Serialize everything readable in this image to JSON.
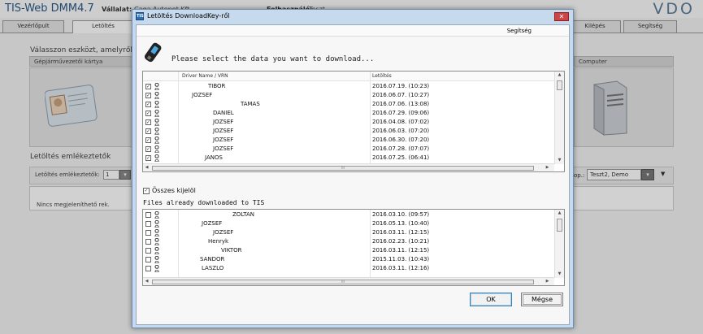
{
  "background": {
    "app_title": "TIS-Web DMM4.7",
    "company_label": "Vállalat:",
    "company_value": "Caga Autonet Kft",
    "user_label": "Felhasználó:",
    "user_value": "Teszt",
    "logo": "VDO",
    "tabs": [
      "Vezérlőpult",
      "Letöltés",
      "Kilépés",
      "Segítség"
    ],
    "choose_text": "Válasszon eszközt, amelyről l",
    "card_panel_label": "Gépjárművezetői kártya",
    "computer_panel_label": "Computer",
    "reminders_title": "Letöltés emlékeztetők",
    "reminders_field_label": "Letöltés emlékeztetők:",
    "reminders_field_value": "1",
    "no_records": "Nincs megjeleníthető rek.",
    "group_label": "op.:",
    "group_value": "Teszt2, Demo"
  },
  "dialog": {
    "title": "Letöltés DownloadKey-ről",
    "close_label": "✕",
    "menu_help": "Segítség",
    "prompt": "Please select the data you want to download...",
    "columns": {
      "driver": "Driver Name / VRN",
      "download": "Letöltés"
    },
    "to_download": [
      {
        "name": "TIBOR",
        "date": "2016.07.19. (10:23)",
        "checked": true
      },
      {
        "name": "JOZSEF",
        "date": "2016.06.07. (10:27)",
        "checked": true
      },
      {
        "name": "TAMAS",
        "date": "2016.07.06. (13:08)",
        "checked": true
      },
      {
        "name": "DANIEL",
        "date": "2016.07.29. (09:06)",
        "checked": true
      },
      {
        "name": "JOZSEF",
        "date": "2016.04.08. (07:02)",
        "checked": true
      },
      {
        "name": "JOZSEF",
        "date": "2016.06.03. (07:20)",
        "checked": true
      },
      {
        "name": "JOZSEF",
        "date": "2016.06.30. (07:20)",
        "checked": true
      },
      {
        "name": "JOZSEF",
        "date": "2016.07.28. (07:07)",
        "checked": true
      },
      {
        "name": "JANOS",
        "date": "2016.07.25. (06:41)",
        "checked": true
      }
    ],
    "select_all_label": "Összes kijelöl",
    "already_label": "Files already downloaded to TIS",
    "already_downloaded": [
      {
        "name": "ZOLTAN",
        "date": "2016.03.10. (09:57)",
        "checked": false
      },
      {
        "name": "JOZSEF",
        "date": "2016.05.13. (10:40)",
        "checked": false
      },
      {
        "name": "JOZSEF",
        "date": "2016.03.11. (12:15)",
        "checked": false
      },
      {
        "name": "Henryk",
        "date": "2016.02.23. (10:21)",
        "checked": false
      },
      {
        "name": "VIKTOR",
        "date": "2016.03.11. (12:15)",
        "checked": false
      },
      {
        "name": "SANDOR",
        "date": "2015.11.03. (10:43)",
        "checked": false
      },
      {
        "name": "LASZLO",
        "date": "2016.03.11. (12:16)",
        "checked": false
      }
    ],
    "ok_label": "OK",
    "cancel_label": "Mégse",
    "scroll_thumb_mark": "III"
  }
}
